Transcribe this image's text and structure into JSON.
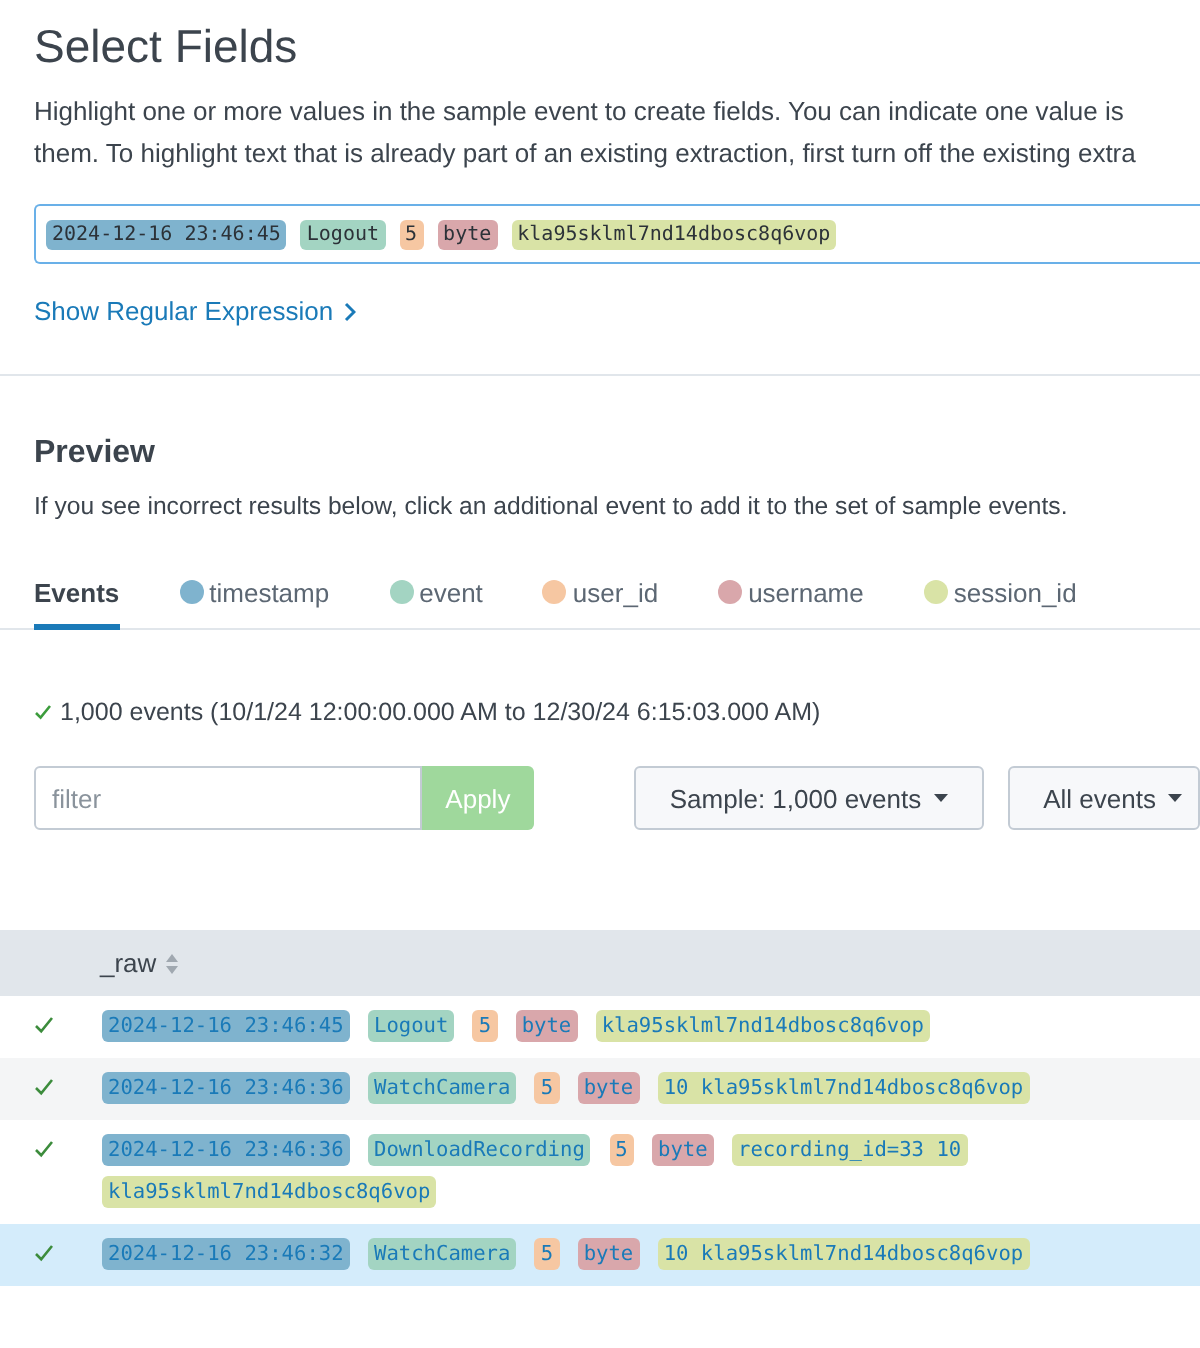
{
  "title": "Select Fields",
  "description": [
    "Highlight one or more values in the sample event to create fields. You can indicate one value is",
    "them. To highlight text that is already part of an existing extraction, first turn off the existing extra"
  ],
  "fields": [
    {
      "name": "timestamp",
      "color": "#7fb3ce"
    },
    {
      "name": "event",
      "color": "#a3d4c2"
    },
    {
      "name": "user_id",
      "color": "#f6c7a2"
    },
    {
      "name": "username",
      "color": "#d9a7ab"
    },
    {
      "name": "session_id",
      "color": "#d9e3a6"
    }
  ],
  "sample_event": [
    {
      "text": "2024-12-16 23:46:45",
      "color": "#7fb3ce"
    },
    {
      "text": "Logout",
      "color": "#a3d4c2"
    },
    {
      "text": "5",
      "color": "#f6c7a2"
    },
    {
      "text": "byte",
      "color": "#d9a7ab"
    },
    {
      "text": "kla95sklml7nd14dbosc8q6vop",
      "color": "#d9e3a6"
    }
  ],
  "show_regex_link": "Show Regular Expression",
  "preview": {
    "heading": "Preview",
    "description": "If you see incorrect results below, click an additional event to add it to the set of sample events.",
    "tabs": [
      {
        "label": "Events",
        "selected": true
      }
    ],
    "summary": "1,000 events (10/1/24 12:00:00.000 AM to 12/30/24 6:15:03.000 AM)",
    "filter": {
      "placeholder": "filter"
    },
    "apply_button": "Apply",
    "sample_dropdown": "Sample: 1,000 events",
    "events_dropdown": "All events",
    "table": {
      "column": "_raw",
      "rows": [
        {
          "selected": false,
          "tokens": [
            {
              "text": "2024-12-16 23:46:45",
              "color": "#7fb3ce"
            },
            {
              "text": "Logout",
              "color": "#a3d4c2"
            },
            {
              "text": "5",
              "color": "#f6c7a2"
            },
            {
              "text": "byte",
              "color": "#d9a7ab"
            },
            {
              "text": "kla95sklml7nd14dbosc8q6vop",
              "color": "#d9e3a6"
            }
          ]
        },
        {
          "selected": false,
          "tokens": [
            {
              "text": "2024-12-16 23:46:36",
              "color": "#7fb3ce"
            },
            {
              "text": "WatchCamera",
              "color": "#a3d4c2"
            },
            {
              "text": "5",
              "color": "#f6c7a2"
            },
            {
              "text": "byte",
              "color": "#d9a7ab"
            },
            {
              "text": "10 kla95sklml7nd14dbosc8q6vop",
              "color": "#d9e3a6"
            }
          ]
        },
        {
          "selected": false,
          "tokens": [
            {
              "text": "2024-12-16 23:46:36",
              "color": "#7fb3ce"
            },
            {
              "text": "DownloadRecording",
              "color": "#a3d4c2"
            },
            {
              "text": "5",
              "color": "#f6c7a2"
            },
            {
              "text": "byte",
              "color": "#d9a7ab"
            },
            {
              "text": "recording_id=33 10",
              "color": "#d9e3a6"
            },
            {
              "text": "kla95sklml7nd14dbosc8q6vop",
              "color": "#d9e3a6"
            }
          ]
        },
        {
          "selected": true,
          "tokens": [
            {
              "text": "2024-12-16 23:46:32",
              "color": "#7fb3ce"
            },
            {
              "text": "WatchCamera",
              "color": "#a3d4c2"
            },
            {
              "text": "5",
              "color": "#f6c7a2"
            },
            {
              "text": "byte",
              "color": "#d9a7ab"
            },
            {
              "text": "10 kla95sklml7nd14dbosc8q6vop",
              "color": "#d9e3a6"
            }
          ]
        }
      ]
    }
  }
}
